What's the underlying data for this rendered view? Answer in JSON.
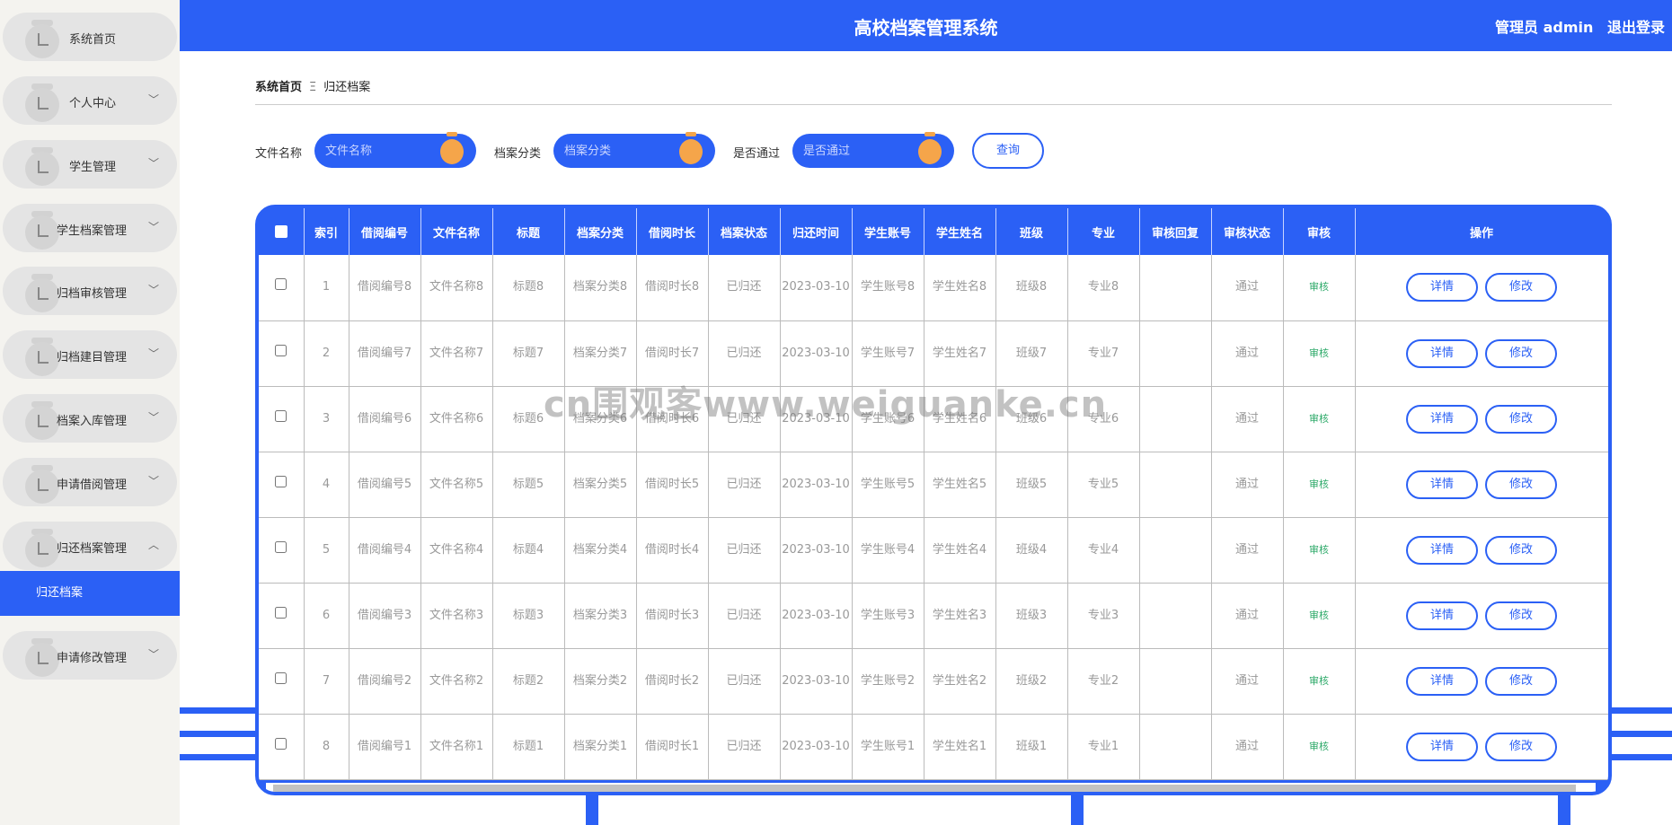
{
  "sidebar": {
    "items": [
      {
        "label": "系统首页",
        "chevron": ""
      },
      {
        "label": "个人中心",
        "chevron": "﹀"
      },
      {
        "label": "学生管理",
        "chevron": "﹀"
      },
      {
        "label": "学生档案管理",
        "chevron": "﹀"
      },
      {
        "label": "归档审核管理",
        "chevron": "﹀"
      },
      {
        "label": "归档建目管理",
        "chevron": "﹀"
      },
      {
        "label": "档案入库管理",
        "chevron": "﹀"
      },
      {
        "label": "申请借阅管理",
        "chevron": "﹀"
      },
      {
        "label": "归还档案管理",
        "chevron": "︿"
      },
      {
        "label": "申请修改管理",
        "chevron": "﹀"
      }
    ],
    "active_sub": "归还档案"
  },
  "header": {
    "title": "高校档案管理系统",
    "user": "管理员 admin",
    "logout": "退出登录"
  },
  "breadcrumb": {
    "home": "系统首页",
    "sep": "Ξ",
    "current": "归还档案"
  },
  "search": {
    "file_label": "文件名称",
    "file_placeholder": "文件名称",
    "category_label": "档案分类",
    "category_placeholder": "档案分类",
    "pass_label": "是否通过",
    "pass_placeholder": "是否通过",
    "button": "查询"
  },
  "table": {
    "headers": [
      "索引",
      "借阅编号",
      "文件名称",
      "标题",
      "档案分类",
      "借阅时长",
      "档案状态",
      "归还时间",
      "学生账号",
      "学生姓名",
      "班级",
      "专业",
      "审核回复",
      "审核状态",
      "审核",
      "操作"
    ],
    "rows": [
      {
        "index": "1",
        "borrow_no": "借阅编号8",
        "file_name": "文件名称8",
        "title": "标题8",
        "category": "档案分类8",
        "duration": "借阅时长8",
        "status": "已归还",
        "return_time": "2023-03-10",
        "account": "学生账号8",
        "student": "学生姓名8",
        "class": "班级8",
        "major": "专业8",
        "reply": "",
        "audit_status": "通过",
        "audit": "审核"
      },
      {
        "index": "2",
        "borrow_no": "借阅编号7",
        "file_name": "文件名称7",
        "title": "标题7",
        "category": "档案分类7",
        "duration": "借阅时长7",
        "status": "已归还",
        "return_time": "2023-03-10",
        "account": "学生账号7",
        "student": "学生姓名7",
        "class": "班级7",
        "major": "专业7",
        "reply": "",
        "audit_status": "通过",
        "audit": "审核"
      },
      {
        "index": "3",
        "borrow_no": "借阅编号6",
        "file_name": "文件名称6",
        "title": "标题6",
        "category": "档案分类6",
        "duration": "借阅时长6",
        "status": "已归还",
        "return_time": "2023-03-10",
        "account": "学生账号6",
        "student": "学生姓名6",
        "class": "班级6",
        "major": "专业6",
        "reply": "",
        "audit_status": "通过",
        "audit": "审核"
      },
      {
        "index": "4",
        "borrow_no": "借阅编号5",
        "file_name": "文件名称5",
        "title": "标题5",
        "category": "档案分类5",
        "duration": "借阅时长5",
        "status": "已归还",
        "return_time": "2023-03-10",
        "account": "学生账号5",
        "student": "学生姓名5",
        "class": "班级5",
        "major": "专业5",
        "reply": "",
        "audit_status": "通过",
        "audit": "审核"
      },
      {
        "index": "5",
        "borrow_no": "借阅编号4",
        "file_name": "文件名称4",
        "title": "标题4",
        "category": "档案分类4",
        "duration": "借阅时长4",
        "status": "已归还",
        "return_time": "2023-03-10",
        "account": "学生账号4",
        "student": "学生姓名4",
        "class": "班级4",
        "major": "专业4",
        "reply": "",
        "audit_status": "通过",
        "audit": "审核"
      },
      {
        "index": "6",
        "borrow_no": "借阅编号3",
        "file_name": "文件名称3",
        "title": "标题3",
        "category": "档案分类3",
        "duration": "借阅时长3",
        "status": "已归还",
        "return_time": "2023-03-10",
        "account": "学生账号3",
        "student": "学生姓名3",
        "class": "班级3",
        "major": "专业3",
        "reply": "",
        "audit_status": "通过",
        "audit": "审核"
      },
      {
        "index": "7",
        "borrow_no": "借阅编号2",
        "file_name": "文件名称2",
        "title": "标题2",
        "category": "档案分类2",
        "duration": "借阅时长2",
        "status": "已归还",
        "return_time": "2023-03-10",
        "account": "学生账号2",
        "student": "学生姓名2",
        "class": "班级2",
        "major": "专业2",
        "reply": "",
        "audit_status": "通过",
        "audit": "审核"
      },
      {
        "index": "8",
        "borrow_no": "借阅编号1",
        "file_name": "文件名称1",
        "title": "标题1",
        "category": "档案分类1",
        "duration": "借阅时长1",
        "status": "已归还",
        "return_time": "2023-03-10",
        "account": "学生账号1",
        "student": "学生姓名1",
        "class": "班级1",
        "major": "专业1",
        "reply": "",
        "audit_status": "通过",
        "audit": "审核"
      }
    ],
    "detail_label": "详情",
    "edit_label": "修改"
  },
  "watermark": "cn围观客www.weiguanke.cn",
  "colors": {
    "accent": "#2b60f5",
    "pin": "#f5a54a",
    "audit": "#2eaa6a"
  }
}
